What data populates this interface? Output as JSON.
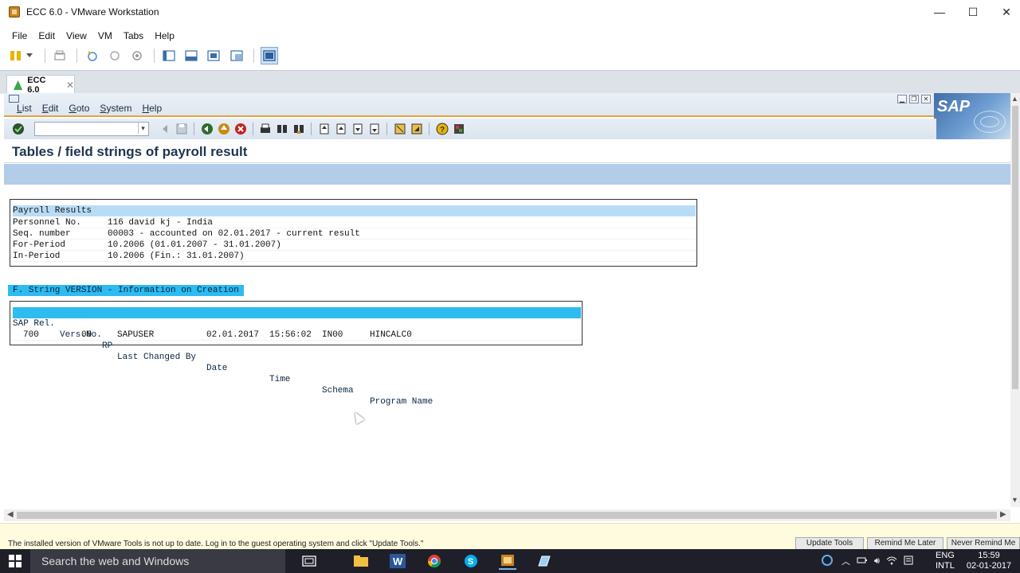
{
  "window": {
    "title": "ECC 6.0 - VMware Workstation",
    "controls": [
      "—",
      "☐",
      "✕"
    ]
  },
  "vmware_menu": [
    "File",
    "Edit",
    "View",
    "VM",
    "Tabs",
    "Help"
  ],
  "vm_tab": {
    "label": "ECC 6.0",
    "close": "✕"
  },
  "sap_menu": [
    "List",
    "Edit",
    "Goto",
    "System",
    "Help"
  ],
  "sap_logo": "SAP",
  "command_field": {
    "value": "",
    "button": "▾"
  },
  "screen_title": "Tables / field strings of payroll result",
  "payroll_results": {
    "header": "Payroll Results",
    "rows": [
      {
        "label": "Personnel No.",
        "value": "116 david kj - India"
      },
      {
        "label": "Seq. number",
        "value": "00003 - accounted on 02.01.2017 - current result"
      },
      {
        "label": "For-Period",
        "value": "10.2006 (01.01.2007 - 31.01.2007)"
      },
      {
        "label": "In-Period",
        "value": "10.2006 (Fin.: 31.01.2007)"
      }
    ]
  },
  "version_section": {
    "title": "F. String VERSION - Information on Creation",
    "columns": [
      "SAP Rel.",
      "Vers.No.",
      "RP",
      "Last Changed By",
      "Date",
      "Time",
      "Schema",
      "Program Name"
    ],
    "row": [
      "700",
      "00",
      "",
      "SAPUSER",
      "02.01.2017",
      "15:56:02",
      "IN00",
      "HINCALC0"
    ]
  },
  "notification": {
    "message": "The installed version of VMware Tools is not up to date. Log in to the guest operating system and click \"Update Tools.\"",
    "buttons": [
      "Update Tools",
      "Remind Me Later",
      "Never Remind Me"
    ]
  },
  "taskbar": {
    "search_placeholder": "Search the web and Windows",
    "language": "ENG",
    "layout": "INTL",
    "time": "15:59",
    "date": "02-01-2017"
  },
  "colors": {
    "sap_header_blue": "#b3cce8",
    "sap_highlight": "#2dbbf0",
    "sap_row_highlight": "#b9dcf6",
    "sap_accent_orange": "#e6a23a",
    "taskbar": "#1f1f2a"
  }
}
